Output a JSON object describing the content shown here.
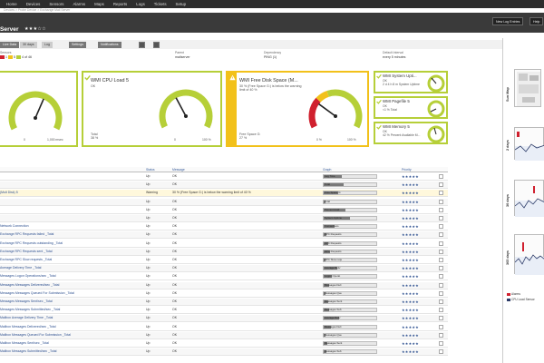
{
  "nav": {
    "menu": [
      "Home",
      "Devices",
      "Sensors",
      "Alarms",
      "Maps",
      "Reports",
      "Logs",
      "Tickets",
      "Setup"
    ],
    "breadcrumb": "Devices  >  Probe Device  >  Exchange Mail Server"
  },
  "header": {
    "title": "Server",
    "stars": "★★★☆☆",
    "new_entry_button": "New Log Entries",
    "help_button": "Help"
  },
  "tabs": {
    "overview": "Overview",
    "live_data": "Live Data",
    "days_2": "2 days",
    "days_30": "30 days",
    "days_365": "365 days",
    "historic": "Historic Data",
    "log": "Log",
    "settings": "Settings",
    "notifications": "Notifications"
  },
  "info": {
    "sensors_label": "Sensors",
    "sensors_counts": [
      "1",
      "5",
      "4 of 46"
    ],
    "parent_label": "Parent",
    "parent_value": "mailserver",
    "dependency_label": "Dependency",
    "dependency_value": "PING (1)",
    "interval_label": "Default Interval",
    "interval_value": "every 5 minutes",
    "id_label": "ID",
    "id_value": "#2081"
  },
  "colors": {
    "ok_green": "#b6cf38",
    "warning_yellow": "#f2c11a",
    "error_red": "#d0202e",
    "link_blue": "#2c4f8f"
  },
  "gauges": [
    {
      "name": "",
      "status": "",
      "footer_label": "",
      "footer_value": "",
      "scale_min": "0",
      "scale_max": "1,000 msec",
      "level": 0.6
    },
    {
      "name": "WMI CPU Load 5",
      "status": "OK",
      "footer_label": "Total",
      "footer_value": "38 %",
      "scale_min": "0",
      "scale_max": "100 %",
      "level": 0.38
    },
    {
      "name": "WMI Free Disk Space (M...",
      "status": "30 % (Free Space G:) is below the warning limit of 40 %",
      "footer_label": "Free Space G:",
      "footer_value": "27 %",
      "scale_min": "0 %",
      "scale_max": "100 %",
      "level": 0.27
    }
  ],
  "mini_gauges": [
    {
      "name": "WMI System Upti...",
      "status": "OK",
      "value": "2 d 4 h 8 m",
      "sub": "System Uptime"
    },
    {
      "name": "WMI Pagefile 5",
      "status": "OK",
      "value": "<1 %",
      "sub": "Total"
    },
    {
      "name": "WMI Memory 5",
      "status": "OK",
      "value": "42 %",
      "sub": "Percent Available M..."
    }
  ],
  "table": {
    "headers": {
      "status": "Status",
      "message": "Message",
      "graph": "Graph",
      "priority": "Priority"
    },
    "rows": [
      {
        "name": "",
        "status": "Up",
        "message": "OK",
        "graph": "Avg Time",
        "fill": 0.35,
        "stars": "★★★★★"
      },
      {
        "name": "",
        "status": "Up",
        "message": "OK",
        "graph": "Total",
        "fill": 0.38,
        "stars": "★★★★★"
      },
      {
        "name": "(Mult Disk) 5",
        "status": "Warning",
        "message": "30 % (Free Space G:) is below the warning limit of 40 %",
        "graph": "Free Space G:",
        "fill": 0.27,
        "stars": "★★★★★"
      },
      {
        "name": "",
        "status": "Up",
        "message": "OK",
        "graph": "Total",
        "fill": 0.02,
        "stars": "★★★★★"
      },
      {
        "name": "",
        "status": "Up",
        "message": "OK",
        "graph": "Percent Avail",
        "fill": 0.42,
        "stars": "★★★★★"
      },
      {
        "name": "",
        "status": "Up",
        "message": "OK",
        "graph": "System Uptime",
        "fill": 0.5,
        "stars": "★★★★★"
      },
      {
        "name": "Network Connection",
        "status": "Up",
        "message": "OK",
        "graph": "Connections",
        "fill": 0.2,
        "stars": "★★★★★"
      },
      {
        "name": "Exchange RPC Requests failed _Total",
        "status": "Up",
        "message": "OK",
        "graph": "RPC Requests",
        "fill": 0.05,
        "stars": "★★★★★"
      },
      {
        "name": "Exchange RPC Requests outstanding _Total",
        "status": "Up",
        "message": "OK",
        "graph": "RPC Requests",
        "fill": 0.08,
        "stars": "★★★★★"
      },
      {
        "name": "Exchange RPC Requests sent _Total",
        "status": "Up",
        "message": "OK",
        "graph": "RPC Requests",
        "fill": 0.12,
        "stars": "★★★★★"
      },
      {
        "name": "Exchange RPC Slow requests _Total",
        "status": "Up",
        "message": "OK",
        "graph": "RPC Slow requ",
        "fill": 0.04,
        "stars": "★★★★★"
      },
      {
        "name": "Average Delivery Time _Total",
        "status": "Up",
        "message": "OK",
        "graph": "Average Deliv",
        "fill": 0.25,
        "stars": "★★★★★"
      },
      {
        "name": "Messages Logon Operations/sec _Total",
        "status": "Up",
        "message": "OK",
        "graph": "Logon Operat",
        "fill": 0.15,
        "stars": "★★★★★"
      },
      {
        "name": "Messages Messages Delivered/sec _Total",
        "status": "Up",
        "message": "OK",
        "graph": "Messages Deli",
        "fill": 0.1,
        "stars": "★★★★★"
      },
      {
        "name": "Messages Messages Queued For Submission _Total",
        "status": "Up",
        "message": "OK",
        "graph": "Messages Que",
        "fill": 0.03,
        "stars": "★★★★★"
      },
      {
        "name": "Messages Messages Sent/sec _Total",
        "status": "Up",
        "message": "OK",
        "graph": "Messages Sent",
        "fill": 0.09,
        "stars": "★★★★★"
      },
      {
        "name": "Messages Messages Submitted/sec _Total",
        "status": "Up",
        "message": "OK",
        "graph": "Messages Sub",
        "fill": 0.11,
        "stars": "★★★★★"
      },
      {
        "name": "Mailbox Average Delivery Time _Total",
        "status": "Up",
        "message": "OK",
        "graph": "Average Deliv",
        "fill": 0.3,
        "stars": "★★★★★"
      },
      {
        "name": "Mailbox Messages Delivered/sec _Total",
        "status": "Up",
        "message": "OK",
        "graph": "Messages Deli",
        "fill": 0.14,
        "stars": "★★★★★"
      },
      {
        "name": "Mailbox Messages Queued For Submission _Total",
        "status": "Up",
        "message": "OK",
        "graph": "Messages Que",
        "fill": 0.02,
        "stars": "★★★★★"
      },
      {
        "name": "Mailbox Messages Sent/sec _Total",
        "status": "Up",
        "message": "OK",
        "graph": "Messages Sent",
        "fill": 0.07,
        "stars": "★★★★★"
      },
      {
        "name": "Mailbox Messages Submitted/sec _Total",
        "status": "Up",
        "message": "OK",
        "graph": "Messages Sub",
        "fill": 0.06,
        "stars": "★★★★★"
      }
    ]
  },
  "side": {
    "sun_map_label": "Sun Map",
    "days2_label": "2 days",
    "days30_label": "30 days",
    "days365_label": "365 days",
    "legend_alarms": "Alarms",
    "legend_cpu": "CPU Load Sensor",
    "legend_colors": [
      "#d0202e",
      "#2b3a67"
    ]
  }
}
